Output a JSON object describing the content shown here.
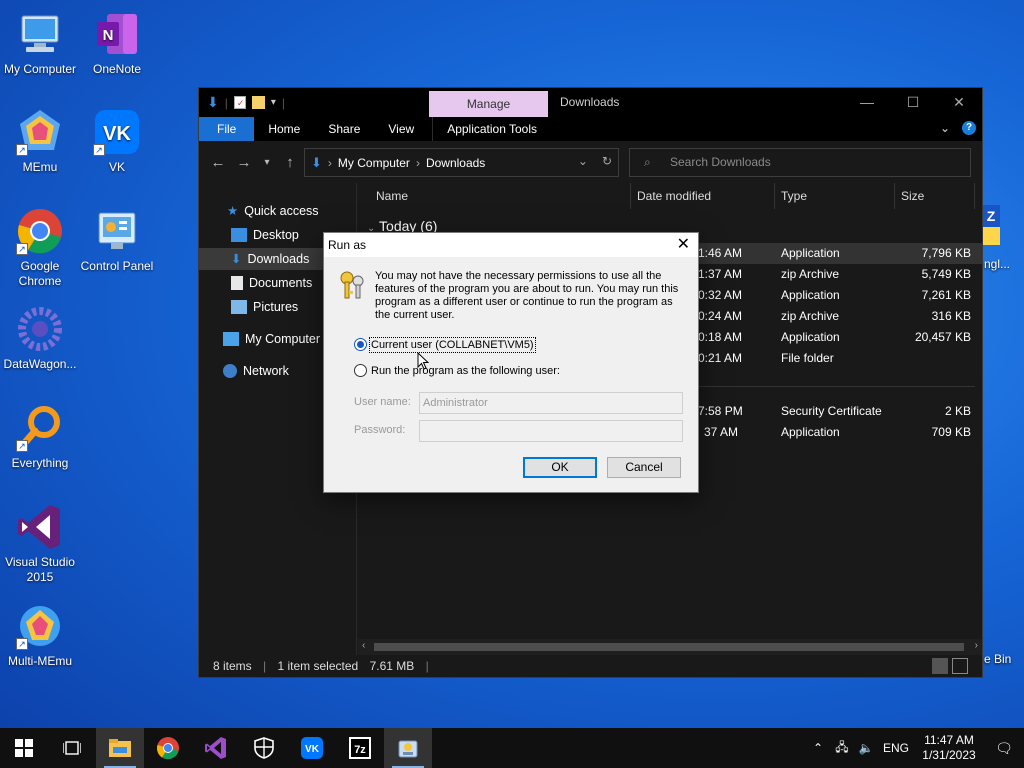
{
  "desktop": {
    "icons": [
      {
        "label": "My Computer",
        "icon": "monitor-icon"
      },
      {
        "label": "OneNote",
        "icon": "onenote-icon"
      },
      {
        "label": "MEmu",
        "icon": "memu-icon"
      },
      {
        "label": "VK",
        "icon": "vk-icon"
      },
      {
        "label": "Google\nChrome",
        "icon": "chrome-icon"
      },
      {
        "label": "Control Panel",
        "icon": "control-panel-icon"
      },
      {
        "label": "DataWagon...",
        "icon": "datawagon-icon"
      },
      {
        "label": "Everything",
        "icon": "everything-icon"
      },
      {
        "label": "Visual Studio\n2015",
        "icon": "visual-studio-icon"
      },
      {
        "label": "Multi-MEmu",
        "icon": "multi-memu-icon"
      }
    ],
    "partial_labels": {
      "right_icon_text": "ngl...",
      "bin_text": "e Bin"
    }
  },
  "explorer": {
    "title": "Downloads",
    "context_tab": "Manage",
    "ribbon_tabs": [
      "File",
      "Home",
      "Share",
      "View",
      "Application Tools"
    ],
    "breadcrumb": [
      "My Computer",
      "Downloads"
    ],
    "search_placeholder": "Search Downloads",
    "nav_pane": {
      "quick_access": "Quick access",
      "items": [
        "Desktop",
        "Downloads",
        "Documents",
        "Pictures"
      ],
      "my_computer": "My Computer",
      "network": "Network"
    },
    "columns": {
      "name": "Name",
      "date": "Date modified",
      "type": "Type",
      "size": "Size"
    },
    "group_label": "Today (6)",
    "rows": [
      {
        "date": "1:46 AM",
        "type": "Application",
        "size": "7,796 KB",
        "selected": true
      },
      {
        "date": "1:37 AM",
        "type": "zip Archive",
        "size": "5,749 KB"
      },
      {
        "date": "0:32 AM",
        "type": "Application",
        "size": "7,261 KB"
      },
      {
        "date": "0:24 AM",
        "type": "zip Archive",
        "size": "316 KB"
      },
      {
        "date": "0:18 AM",
        "type": "Application",
        "size": "20,457 KB"
      },
      {
        "date": "0:21 AM",
        "type": "File folder",
        "size": ""
      },
      {
        "date": "7:58 PM",
        "type": "Security Certificate",
        "size": "2 KB"
      },
      {
        "date": "37 AM",
        "type": "Application",
        "size": "709 KB"
      }
    ],
    "status": {
      "items": "8 items",
      "selected": "1 item selected",
      "size": "7.61 MB"
    }
  },
  "runas": {
    "title": "Run as",
    "message": "You may not have the necessary permissions to use all the features of the program you are about to run. You may run this program as a different user or continue to run the program as the current user.",
    "option_current": "Current user (COLLABNET\\VM5)",
    "option_other": "Run the program as the following user:",
    "username_label": "User name:",
    "username_value": "Administrator",
    "password_label": "Password:",
    "password_value": "",
    "ok": "OK",
    "cancel": "Cancel",
    "selected_option": "current"
  },
  "taskbar": {
    "items": [
      "start-icon",
      "task-view-icon",
      "file-explorer-icon",
      "chrome-icon",
      "visual-studio-icon",
      "security-icon",
      "vk-icon",
      "7zip-icon",
      "runas-app-icon"
    ],
    "language": "ENG",
    "time": "11:47 AM",
    "date": "1/31/2023"
  },
  "colors": {
    "desktop": "#1665d6",
    "accent": "#1a6fd2",
    "manage_tab": "#e6c8ee"
  }
}
